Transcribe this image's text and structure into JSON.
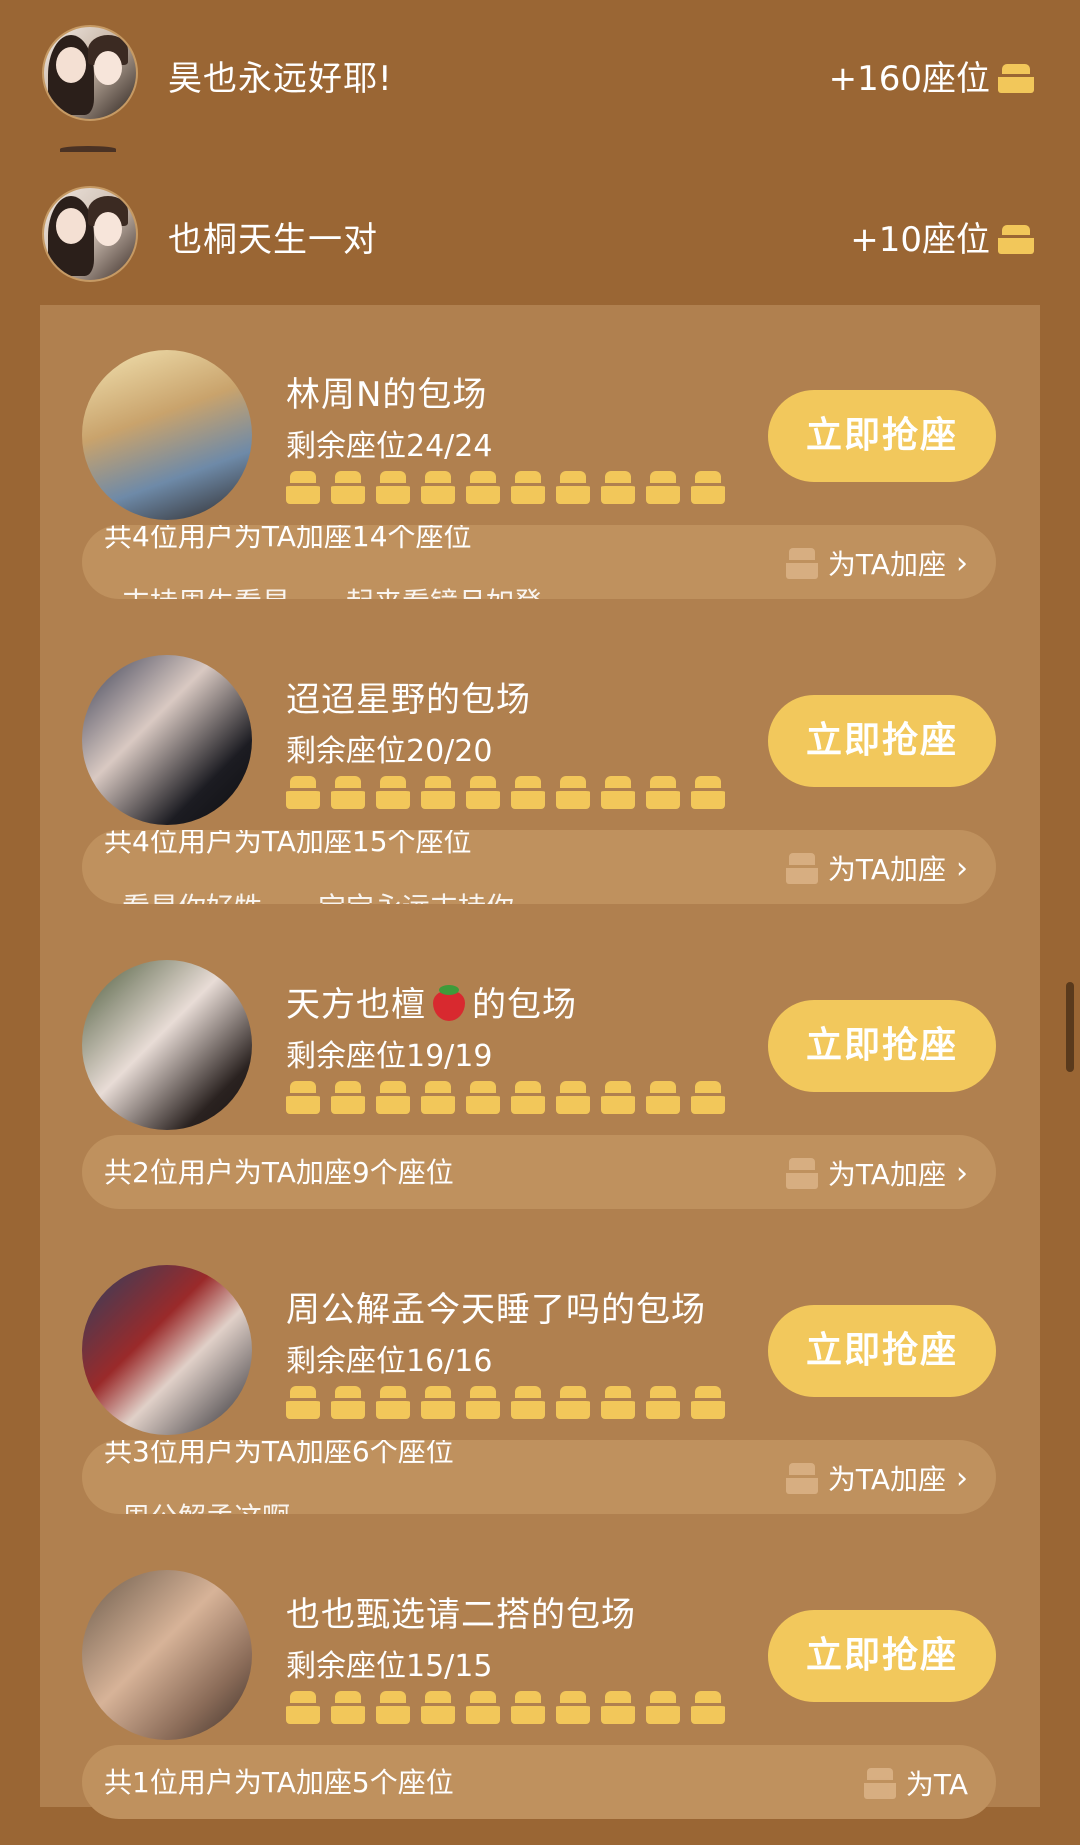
{
  "top_rows": [
    {
      "name": "昊也永远好耶!",
      "seats": "+160座位"
    },
    {
      "name": "也桐天生一对",
      "seats": "+10座位"
    }
  ],
  "cards": [
    {
      "title": "林周N的包场",
      "remaining": "剩余座位24/24",
      "button": "立即抢座",
      "users_text": "共4位用户为TA加座14个座位",
      "add_label": "为TA加座",
      "ghost_text": "支持周生看星…一起来看镜月如登"
    },
    {
      "title": "迢迢星野的包场",
      "remaining": "剩余座位20/20",
      "button": "立即抢座",
      "users_text": "共4位用户为TA加座15个座位",
      "add_label": "为TA加座",
      "ghost_text": "看是你好牲……宝宝永远支持你"
    },
    {
      "title_a": "天方也檀",
      "title_b": "的包场",
      "remaining": "剩余座位19/19",
      "button": "立即抢座",
      "users_text": "共2位用户为TA加座9个座位",
      "add_label": "为TA加座"
    },
    {
      "title": "周公解孟今天睡了吗的包场",
      "remaining": "剩余座位16/16",
      "button": "立即抢座",
      "users_text": "共3位用户为TA加座6个座位",
      "add_label": "为TA加座",
      "ghost_text": "周公解孟这啊"
    },
    {
      "title": "也也甄选请二搭的包场",
      "remaining": "剩余座位15/15",
      "button": "立即抢座",
      "users_text": "共1位用户为TA加座5个座位",
      "add_label": "为TA"
    }
  ],
  "icons": {
    "seat": "seat-icon",
    "add": "add-seat-icon",
    "chevron": "chevron-right-icon",
    "strawberry": "strawberry-emoji"
  },
  "colors": {
    "background": "#9a6634",
    "panel": "#b0804f",
    "button": "#f2c85c",
    "seat": "#f2c75a"
  }
}
